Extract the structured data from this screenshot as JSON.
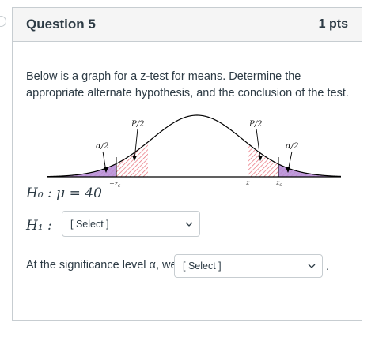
{
  "question": {
    "title": "Question 5",
    "points": "1 pts",
    "prompt": "Below is a graph for a z-test for means.  Determine the appropriate alternate hypothesis, and the conclusion of the test."
  },
  "graph": {
    "labels": {
      "p_half_left": "P/2",
      "p_half_right": "P/2",
      "alpha_half_left": "α/2",
      "alpha_half_right": "α/2",
      "neg_zc": "−z",
      "z": "z",
      "zc": "z"
    },
    "colors": {
      "alpha_fill": "#b48ad6",
      "p_hatch": "#e8707a",
      "curve": "#000000"
    }
  },
  "h0": {
    "text": "H₀ : μ = 40"
  },
  "h1": {
    "label": "H₁ :",
    "select_value": "[ Select ]"
  },
  "conclusion": {
    "text": "At the significance level α, we",
    "select_value": "[ Select ]",
    "end": "."
  }
}
